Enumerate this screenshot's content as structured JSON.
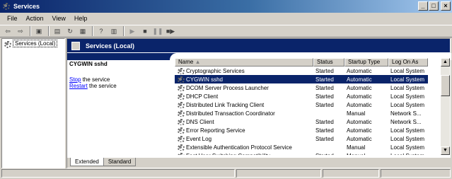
{
  "window": {
    "title": "Services"
  },
  "menu": [
    "File",
    "Action",
    "View",
    "Help"
  ],
  "tree": {
    "root_label": "Services (Local)"
  },
  "panel": {
    "header": "Services (Local)"
  },
  "detail": {
    "service_name": "CYGWIN sshd",
    "stop_link": "Stop",
    "stop_suffix": " the service",
    "restart_link": "Restart",
    "restart_suffix": " the service"
  },
  "columns": [
    "Name",
    "Status",
    "Startup Type",
    "Log On As"
  ],
  "rows": [
    {
      "name": "Cryptographic Services",
      "status": "Started",
      "startup": "Automatic",
      "logon": "Local System"
    },
    {
      "name": "CYGWIN sshd",
      "status": "Started",
      "startup": "Automatic",
      "logon": "Local System",
      "selected": true
    },
    {
      "name": "DCOM Server Process Launcher",
      "status": "Started",
      "startup": "Automatic",
      "logon": "Local System"
    },
    {
      "name": "DHCP Client",
      "status": "Started",
      "startup": "Automatic",
      "logon": "Local System"
    },
    {
      "name": "Distributed Link Tracking Client",
      "status": "Started",
      "startup": "Automatic",
      "logon": "Local System"
    },
    {
      "name": "Distributed Transaction Coordinator",
      "status": "",
      "startup": "Manual",
      "logon": "Network S..."
    },
    {
      "name": "DNS Client",
      "status": "Started",
      "startup": "Automatic",
      "logon": "Network S..."
    },
    {
      "name": "Error Reporting Service",
      "status": "Started",
      "startup": "Automatic",
      "logon": "Local System"
    },
    {
      "name": "Event Log",
      "status": "Started",
      "startup": "Automatic",
      "logon": "Local System"
    },
    {
      "name": "Extensible Authentication Protocol Service",
      "status": "",
      "startup": "Manual",
      "logon": "Local System"
    },
    {
      "name": "Fast User Switching Compatibility",
      "status": "Started",
      "startup": "Manual",
      "logon": "Local System"
    }
  ],
  "tabs": [
    "Extended",
    "Standard"
  ]
}
